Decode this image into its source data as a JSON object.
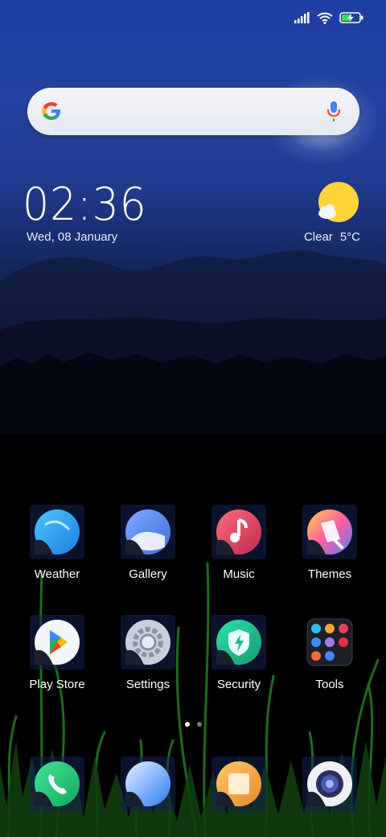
{
  "status": {
    "icons": [
      "signal-icon",
      "wifi-icon",
      "battery-charging-icon"
    ]
  },
  "search": {
    "logo": "google-logo-icon",
    "mic": "microphone-icon"
  },
  "clock": {
    "time": "02:36",
    "date": "Wed, 08 January"
  },
  "weather": {
    "condition": "Clear",
    "temperature": "5°C",
    "icon": "sun-cloud-icon"
  },
  "apps": {
    "row1": [
      {
        "label": "Weather"
      },
      {
        "label": "Gallery"
      },
      {
        "label": "Music"
      },
      {
        "label": "Themes"
      }
    ],
    "row2": [
      {
        "label": "Play Store"
      },
      {
        "label": "Settings"
      },
      {
        "label": "Security"
      },
      {
        "label": "Tools"
      }
    ]
  },
  "dock": [
    "phone-icon",
    "messages-icon",
    "notes-icon",
    "camera-icon"
  ],
  "pages": {
    "count": 2,
    "active": 1
  },
  "colors": {
    "weather": "#29a8f0",
    "gallery": "#5a8dee",
    "music": "#e8405c",
    "security": "#1fbf8f",
    "phone": "#1fcf7a",
    "browser": "#3a8ff0",
    "notes": "#f0a13a",
    "sun": "#ffd43b"
  }
}
